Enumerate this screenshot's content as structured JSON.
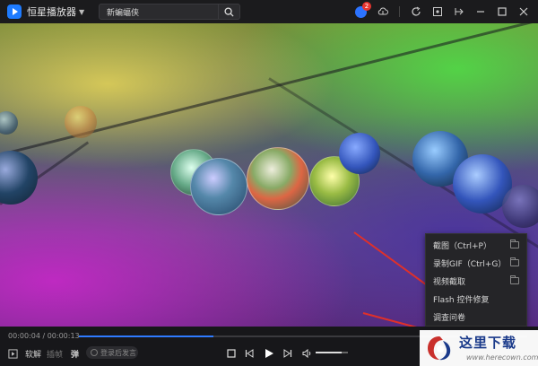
{
  "titlebar": {
    "app_name": "恒星播放器",
    "search_value": "新蝙蝠侠",
    "notification_count": "2"
  },
  "context_menu": {
    "items": [
      {
        "label": "截图（Ctrl+P）",
        "has_folder": true
      },
      {
        "label": "录制GIF（Ctrl+G）",
        "has_folder": true
      },
      {
        "label": "视频截取",
        "has_folder": true
      },
      {
        "label": "Flash 控件修复",
        "has_folder": false
      },
      {
        "label": "调查问卷",
        "has_folder": false
      }
    ]
  },
  "player": {
    "time": "00:00:04 / 00:00:13",
    "progress": 0.3,
    "volume": 0.8,
    "decode_label": "软解",
    "subtitle_label": "插帧",
    "danmaku_label": "弹",
    "send_placeholder": "登录后发言"
  },
  "watermark": {
    "title": "这里下载",
    "subtitle": "www.herecown.com"
  },
  "colors": {
    "accent": "#2f7bff",
    "arrow": "#e0302a"
  }
}
